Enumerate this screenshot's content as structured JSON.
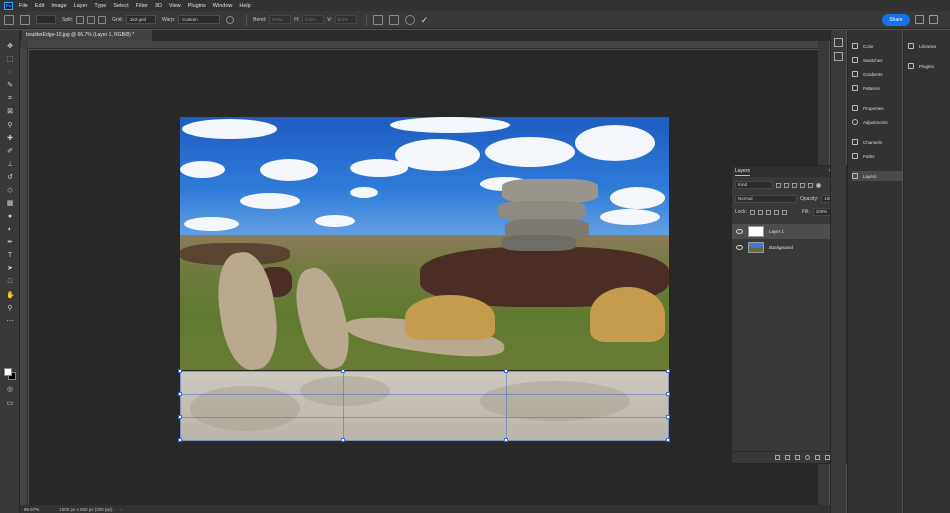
{
  "menubar": {
    "app_icon": "Ps",
    "items": [
      "File",
      "Edit",
      "Image",
      "Layer",
      "Type",
      "Select",
      "Filter",
      "3D",
      "View",
      "Plugins",
      "Window",
      "Help"
    ]
  },
  "options": {
    "split_label": "Split:",
    "grid_label": "Grid:",
    "grid_value": "3x3 grid",
    "warp_label": "Warp:",
    "warp_value": "Custom",
    "bend_label": "Bend:",
    "h_label": "H:",
    "v_label": "V:",
    "bend_value": "0.0%",
    "h_value": "0.0%",
    "v_value": "0.0%",
    "share_label": "Share"
  },
  "document": {
    "tab_title": "boulderEdge-10.jpg @ 66.7% (Layer 1, RGB/8) *",
    "status_zoom": "66.67%",
    "status_info": "1000 px x 560 px (300 ppi)"
  },
  "layers_panel": {
    "tab_label": "Layers",
    "filter_value": "Kind",
    "blend_mode": "Normal",
    "opacity_label": "Opacity:",
    "opacity_value": "100%",
    "lock_label": "Lock:",
    "fill_label": "Fill:",
    "fill_value": "100%",
    "layers": [
      {
        "name": "Layer 1",
        "selected": true
      },
      {
        "name": "Background",
        "selected": false
      }
    ]
  },
  "dock": {
    "items": [
      "Color",
      "Swatches",
      "Gradients",
      "Patterns",
      "Properties",
      "Adjustments",
      "Channels",
      "Paths",
      "Layers"
    ],
    "active": "Layers",
    "right_items": [
      "Libraries",
      "Plugins"
    ]
  },
  "colors": {
    "accent": "#1473e6",
    "app_bg": "#535353",
    "panel_bg": "#383838"
  }
}
